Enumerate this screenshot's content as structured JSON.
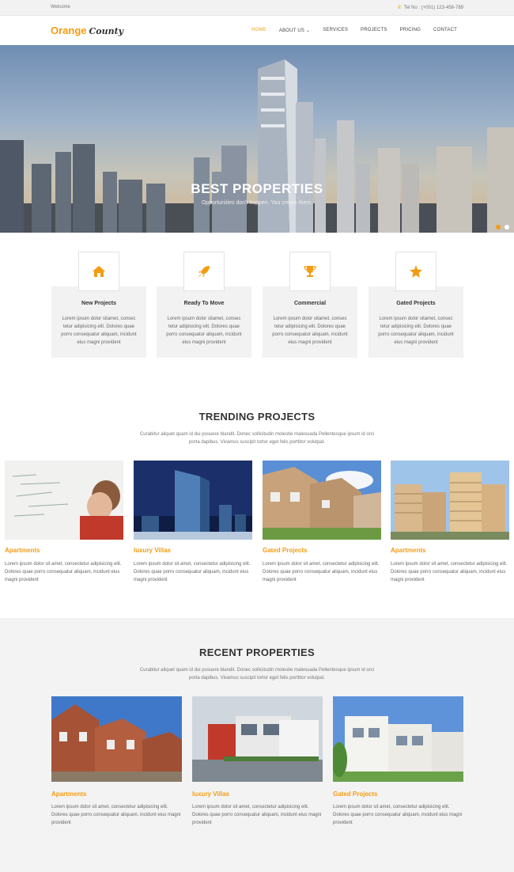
{
  "topbar": {
    "welcome": "Welcome",
    "phone": "Tel No : (+001) 123-456-789"
  },
  "header": {
    "logo_primary": "Orange",
    "logo_secondary": "County",
    "nav": [
      "HOME",
      "ABOUT US",
      "SERVICES",
      "PROJECTS",
      "PRICING",
      "CONTACT"
    ],
    "active_index": 0
  },
  "hero": {
    "title": "BEST PROPERTIES",
    "subtitle": "Opportunities don't happen. You create them.",
    "slides": 2,
    "active_slide": 0
  },
  "features": [
    {
      "icon": "home-icon",
      "title": "New Projects",
      "text": "Lorem ipsum dolor sitamet, consec tetur adipisicing elit. Dolores quae porro consequatur aliquam, incidunt eius magni provident"
    },
    {
      "icon": "rocket-icon",
      "title": "Ready To Move",
      "text": "Lorem ipsum dolor sitamet, consec tetur adipisicing elit. Dolores quae porro consequatur aliquam, incidunt eius magni provident"
    },
    {
      "icon": "trophy-icon",
      "title": "Commercial",
      "text": "Lorem ipsum dolor sitamet, consec tetur adipisicing elit. Dolores quae porro consequatur aliquam, incidunt eius magni provident"
    },
    {
      "icon": "star-icon",
      "title": "Gated Projects",
      "text": "Lorem ipsum dolor sitamet, consec tetur adipisicing elit. Dolores quae porro consequatur aliquam, incidunt eius magni provident"
    }
  ],
  "trending": {
    "title": "TRENDING PROJECTS",
    "subtitle": "Curabitur aliquet quam id dui posuere blandit. Donec sollicitudin molestie malesuada Pellentesque ipsum id orci porta dapibus. Vivamus suscipit tortor eget felis porttitor volutpat.",
    "items": [
      {
        "title": "Apartments",
        "text": "Lorem ipsum dolor sit amet, consectetur adipisicing elit. Dolores quae porro consequatur aliquam, incidunt eius magni provident"
      },
      {
        "title": "luxury Villas",
        "text": "Lorem ipsum dolor sit amet, consectetur adipisicing elit. Dolores quae porro consequatur aliquam, incidunt eius magni provident"
      },
      {
        "title": "Gated Projects",
        "text": "Lorem ipsum dolor sit amet, consectetur adipisicing elit. Dolores quae porro consequatur aliquam, incidunt eius magni provident"
      },
      {
        "title": "Apartments",
        "text": "Lorem ipsum dolor sit amet, consectetur adipisicing elit. Dolores quae porro consequatur aliquam, incidunt eius magni provident"
      }
    ]
  },
  "recent": {
    "title": "RECENT PROPERTIES",
    "subtitle": "Curabitur aliquet quam id dui posuere blandit. Donec sollicitudin molestie malesuada Pellentesque ipsum id orci porta dapibus. Vivamus suscipit tortor eget felis porttitor volutpat.",
    "items": [
      {
        "title": "Apartments",
        "text": "Lorem ipsum dolor sit amet, consectetur adipisicing elit. Dolores quae porro consequatur aliquam, incidunt eius magni provident"
      },
      {
        "title": "luxury Villas",
        "text": "Lorem ipsum dolor sit amet, consectetur adipisicing elit. Dolores quae porro consequatur aliquam, incidunt eius magni provident"
      },
      {
        "title": "Gated Projects",
        "text": "Lorem ipsum dolor sit amet, consectetur adipisicing elit. Dolores quae porro consequatur aliquam, incidunt eius magni provident"
      }
    ]
  },
  "colors": {
    "accent": "#f39c12",
    "text": "#444444",
    "muted_bg": "#f3f3f3"
  }
}
